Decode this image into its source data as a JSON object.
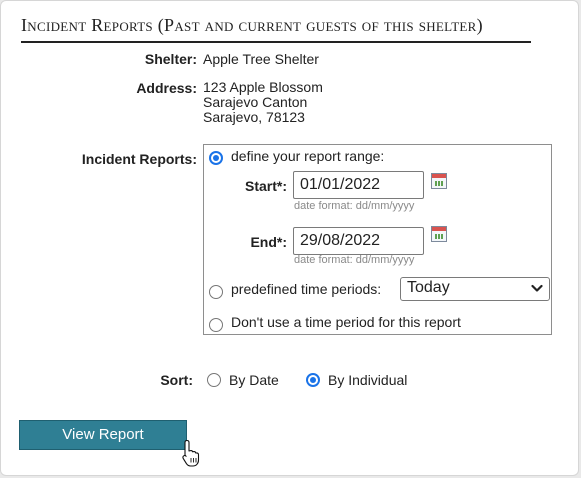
{
  "title": "Incident Reports (Past and current guests of this shelter)",
  "shelter": {
    "label": "Shelter:",
    "value": "Apple Tree Shelter"
  },
  "address": {
    "label": "Address:",
    "lines": [
      "123 Apple Blossom",
      "Sarajevo Canton",
      "Sarajevo, 78123"
    ]
  },
  "incident": {
    "label": "Incident Reports:",
    "option_range": "define your report range:",
    "start": {
      "label": "Start*:",
      "value": "01/01/2022",
      "hint": "date format: dd/mm/yyyy"
    },
    "end": {
      "label": "End*:",
      "value": "29/08/2022",
      "hint": "date format: dd/mm/yyyy"
    },
    "option_predefined": "predefined time periods:",
    "predefined_selected": "Today",
    "option_none": "Don't use a time period for this report",
    "selected_option": "range"
  },
  "sort": {
    "label": "Sort:",
    "by_date": "By Date",
    "by_individual": "By Individual",
    "selected": "by_individual"
  },
  "view_report_label": "View Report",
  "colors": {
    "button": "#2f7f94",
    "radio_accent": "#1a73e8"
  },
  "icons": [
    "calendar-icon",
    "chevron-down-icon",
    "mouse-pointer-icon"
  ]
}
